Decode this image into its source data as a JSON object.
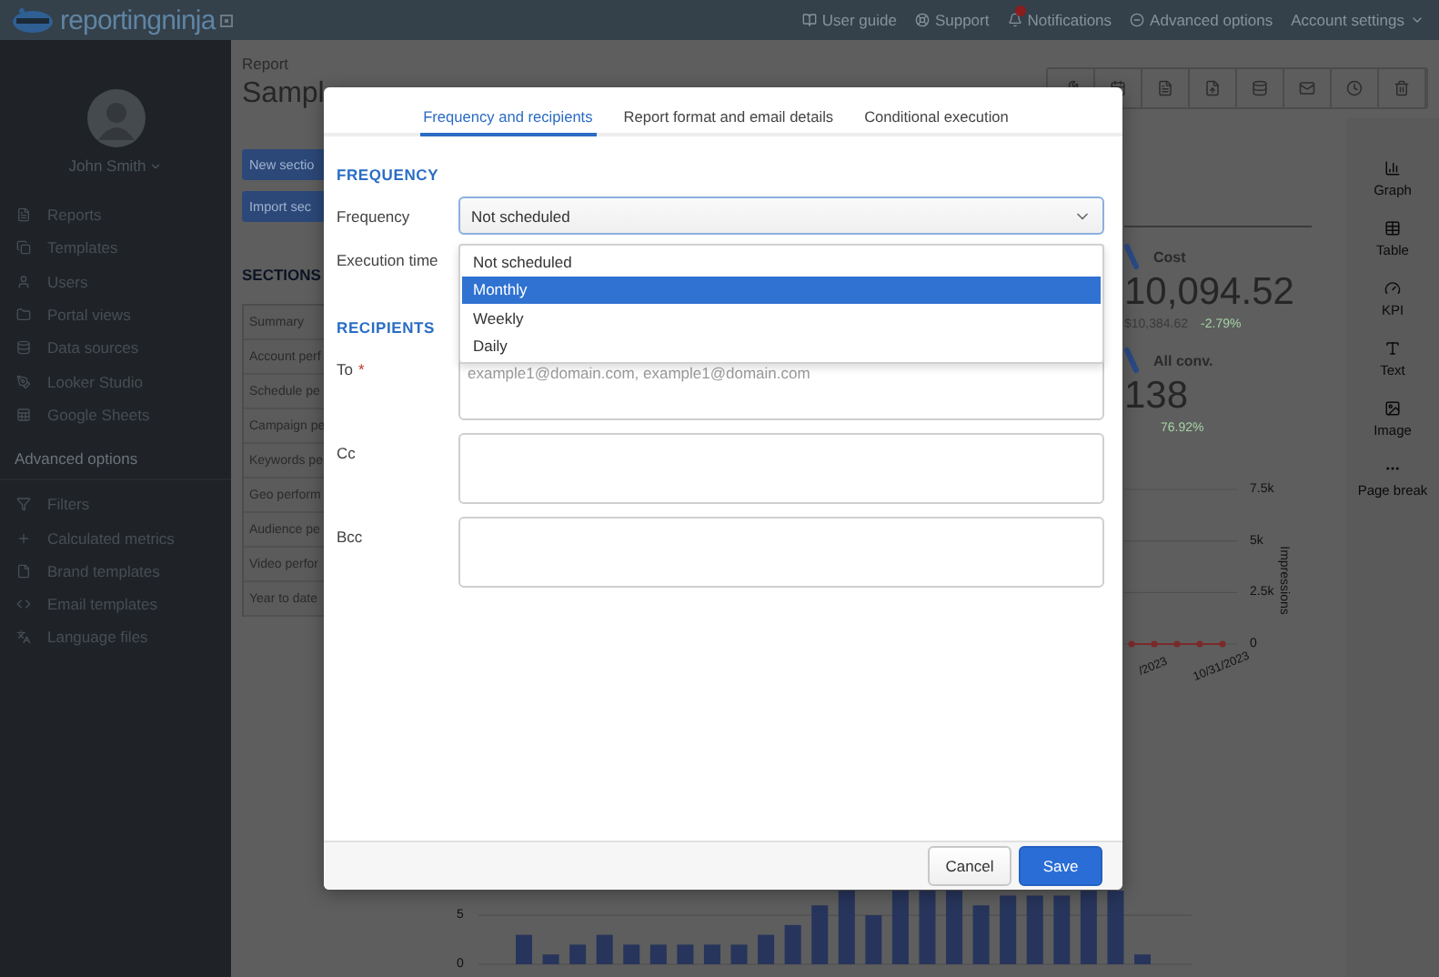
{
  "top_bar": {
    "logo": "reportingninja",
    "links": [
      {
        "label": "User guide"
      },
      {
        "label": "Support"
      },
      {
        "label": "Notifications",
        "has_alert": true
      },
      {
        "label": "Advanced options"
      },
      {
        "label": "Account settings"
      }
    ]
  },
  "sidebar": {
    "user_name": "John Smith",
    "items": [
      "Reports",
      "Templates",
      "Users",
      "Portal views",
      "Data sources",
      "Looker Studio",
      "Google Sheets"
    ],
    "group_label": "Advanced options",
    "advanced_items": [
      "Filters",
      "Calculated metrics",
      "Brand templates",
      "Email templates",
      "Language files"
    ]
  },
  "report": {
    "breadcrumb": "Report",
    "title": "Sampl",
    "buttons": [
      "New sectio",
      "Import sec"
    ],
    "sections_heading": "SECTIONS",
    "sections": [
      "Summary",
      "Account perf",
      "Schedule pe",
      "Campaign pe",
      "Keywords pe",
      "Geo perform",
      "Audience pe",
      "Video perfor",
      "Year to date"
    ]
  },
  "kpis": [
    {
      "label": "Cost",
      "value": "10,094.52",
      "previous": "$10,384.62",
      "change": "-2.79%"
    },
    {
      "label": "All conv.",
      "value": "138",
      "change": "76.92%"
    }
  ],
  "line_chart": {
    "chart_data": {
      "type": "line",
      "categories": [
        null,
        "/2023",
        null,
        null,
        "10/31/2023"
      ],
      "yticks": [
        {
          "value": 0,
          "label": "0"
        },
        {
          "value": 2500,
          "label": "2.5k"
        },
        {
          "value": 5000,
          "label": "5k"
        },
        {
          "value": 7500,
          "label": "7.5k"
        }
      ],
      "ylim": [
        0,
        7500
      ],
      "series": [
        {
          "name": "Impressions",
          "color": "#7a2a2a",
          "marker": "circle",
          "values": [
            0,
            0,
            0,
            0,
            0
          ]
        }
      ]
    }
  },
  "insert_panel": {
    "items": [
      "Graph",
      "Table",
      "KPI",
      "Text",
      "Image",
      "Page break"
    ]
  },
  "bottom_chart": {
    "chart_data": {
      "type": "bar",
      "yticks": [
        0,
        5
      ],
      "ylim": [
        0,
        7.6
      ],
      "categories": [
        null,
        null,
        null,
        null,
        null,
        null,
        null,
        null,
        null,
        null,
        null,
        null,
        null,
        null,
        null,
        null,
        null,
        null,
        null,
        null,
        null,
        null,
        null,
        null
      ],
      "series": [
        {
          "color": "#27355c",
          "values": [
            3,
            1,
            2,
            3,
            2,
            2,
            2,
            2,
            2,
            3,
            4,
            6,
            7.5,
            5,
            7.5,
            7.5,
            7.5,
            6,
            7,
            7,
            7,
            7.5,
            7.5,
            1
          ]
        }
      ]
    }
  },
  "modal": {
    "tabs": [
      {
        "label": "Frequency and recipients",
        "selected": true
      },
      {
        "label": "Report format and email details",
        "selected": false
      },
      {
        "label": "Conditional execution",
        "selected": false
      }
    ],
    "frequency_heading": "FREQUENCY",
    "frequency": {
      "label": "Frequency",
      "value": "Not scheduled",
      "expanded": true,
      "options": [
        {
          "label": "Not scheduled",
          "highlighted": false
        },
        {
          "label": "Monthly",
          "highlighted": true
        },
        {
          "label": "Weekly",
          "highlighted": false
        },
        {
          "label": "Daily",
          "highlighted": false
        }
      ]
    },
    "execution_time": {
      "label": "Execution time"
    },
    "recipients_heading": "RECIPIENTS",
    "to": {
      "label": "To",
      "required_mark": "*",
      "placeholder": "example1@domain.com, example1@domain.com"
    },
    "cc": {
      "label": "Cc"
    },
    "bcc": {
      "label": "Bcc"
    },
    "cancel": "Cancel",
    "save": "Save"
  }
}
